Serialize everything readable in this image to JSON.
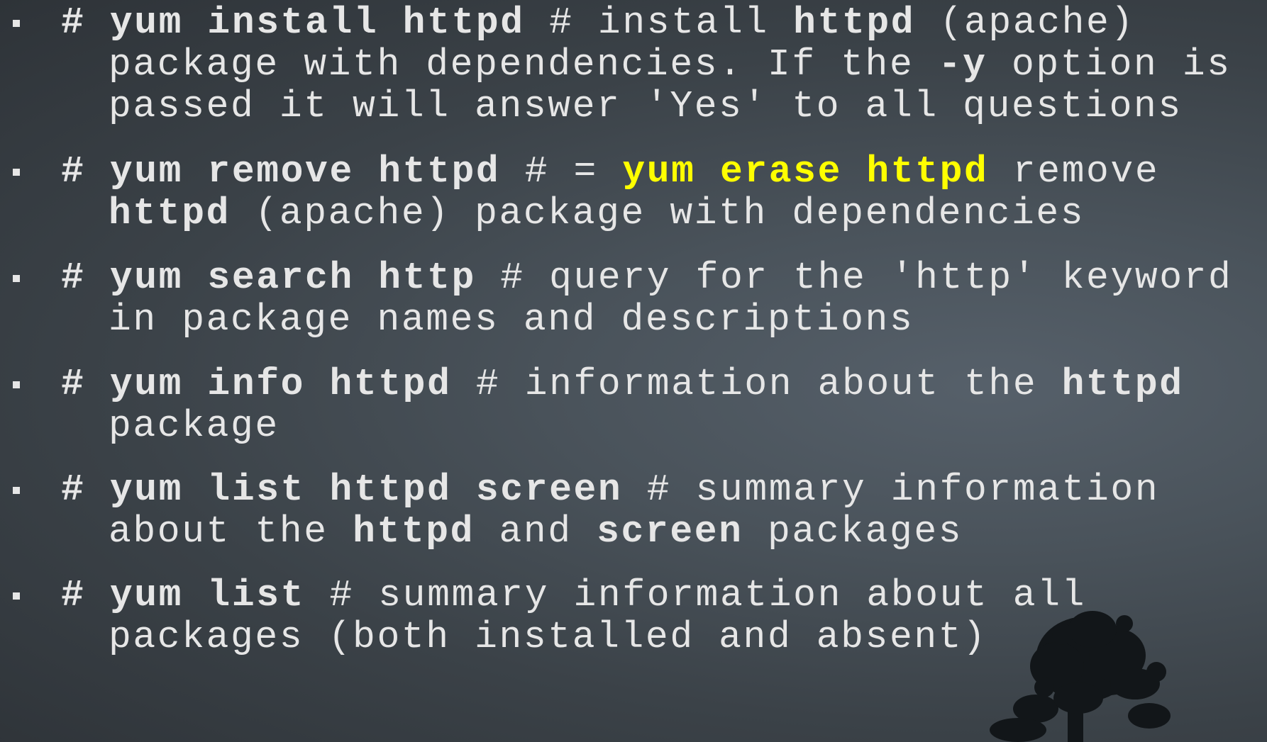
{
  "slide": {
    "bullets": [
      {
        "line1": {
          "hash": "#",
          "cmd": "yum install httpd",
          "rest": " # install ",
          "pkg": "httpd",
          "tail": " (apache)"
        },
        "line2": {
          "pre": "package with dependencies. If the ",
          "opt": "-y",
          "post": " option is"
        },
        "line3": "passed it will answer 'Yes' to all questions"
      },
      {
        "line1": {
          "hash": "#",
          "cmd": "yum remove httpd",
          "rest": " # = ",
          "alias": "yum erase httpd",
          "tail": " remove"
        },
        "line2": {
          "pkg": "httpd",
          "rest": " (apache) package with dependencies"
        }
      },
      {
        "line1": {
          "hash": "#",
          "cmd": "yum search http",
          "rest": " # query for the 'http' keyword"
        },
        "line2": "in package names and descriptions"
      },
      {
        "line1": {
          "hash": "#",
          "cmd": "yum info httpd",
          "rest": " # information about the ",
          "pkg": "httpd"
        },
        "line2": "package"
      },
      {
        "line1": {
          "hash": "#",
          "cmd": "yum list httpd screen",
          "rest": " # summary information"
        },
        "line2": {
          "pre": "about the ",
          "pkg1": "httpd",
          "mid": " and ",
          "pkg2": "screen",
          "post": " packages"
        }
      },
      {
        "line1": {
          "hash": "#",
          "cmd": "yum list",
          "rest": " # summary information about all"
        },
        "line2": "packages (both installed and absent)"
      }
    ]
  },
  "colors": {
    "text": "#e6e6e6",
    "highlight": "#ffff00",
    "background": "#3b4248"
  },
  "decor": {
    "tree": "tree-silhouette-icon"
  }
}
